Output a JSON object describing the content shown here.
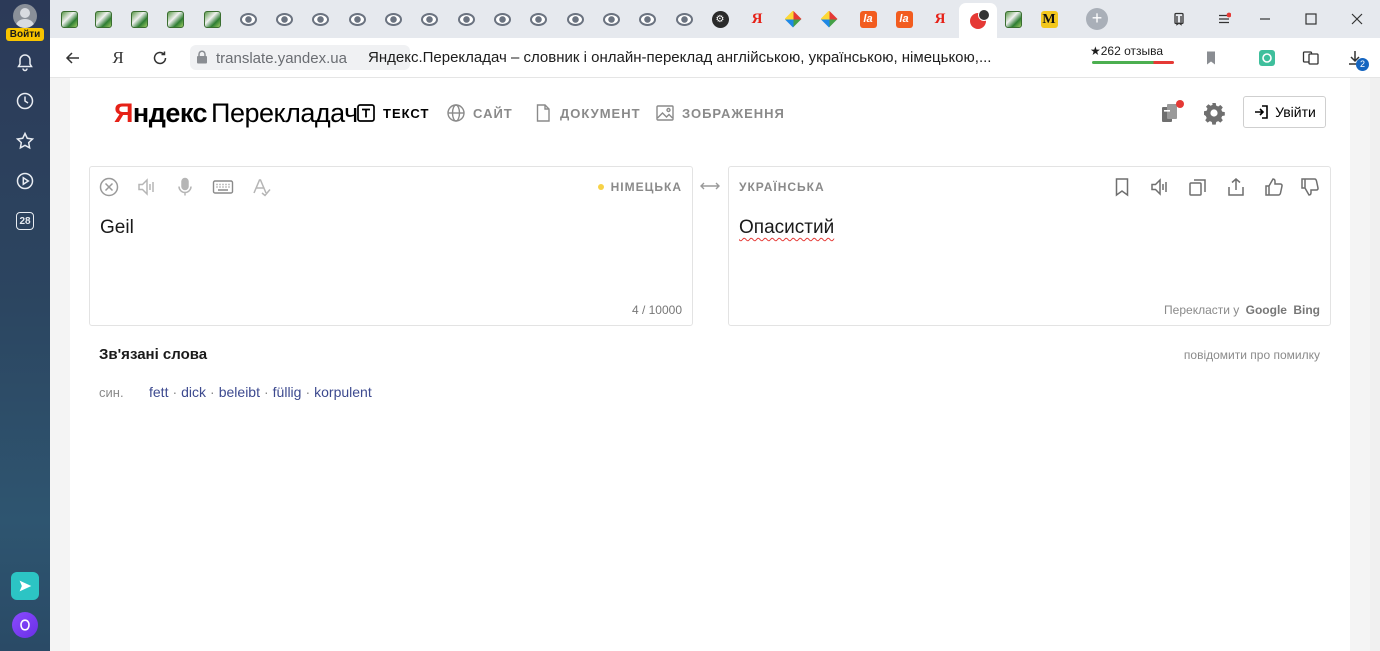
{
  "sidebar": {
    "login_label": "Войти",
    "calendar_day": "28",
    "icons": [
      "bell-icon",
      "history-icon",
      "star-icon",
      "play-icon",
      "calendar-icon",
      "send-app-icon",
      "alice-icon"
    ]
  },
  "tabs": {
    "favicons": [
      "image",
      "image",
      "image",
      "image",
      "image",
      "eye",
      "eye",
      "eye",
      "eye",
      "eye",
      "eye",
      "eye",
      "eye",
      "eye",
      "eye",
      "eye",
      "eye",
      "eye",
      "dark",
      "yandex",
      "multi",
      "multi",
      "la",
      "la",
      "yandex",
      "active",
      "image",
      "m"
    ],
    "new_tab": "+"
  },
  "address_bar": {
    "yandex_button": "Я",
    "domain": "translate.yandex.ua",
    "page_title": "Яндекс.Перекладач – словник і онлайн-переклад англійською, українською, німецькою,...",
    "reviews": "★262 отзыва",
    "downloads_count": "2"
  },
  "header": {
    "logo_part1_first": "Я",
    "logo_part1_rest": "ндекс",
    "logo_part2": "Перекладач",
    "nav": [
      {
        "label": "ТЕКСТ",
        "active": true
      },
      {
        "label": "САЙТ",
        "active": false
      },
      {
        "label": "ДОКУМЕНТ",
        "active": false
      },
      {
        "label": "ЗОБРАЖЕННЯ",
        "active": false
      }
    ],
    "login_label": "Увійти"
  },
  "source": {
    "language": "НІМЕЦЬКА",
    "text": "Geil",
    "char_count": "4 / 10000"
  },
  "target": {
    "language": "УКРАЇНСЬКА",
    "text": "Опасистий",
    "also_translate_label": "Перекласти у",
    "engine_google": "Google",
    "engine_bing": "Bing"
  },
  "related": {
    "title": "Зв'язані слова",
    "report_link": "повідомити про помилку",
    "syn_label": "син.",
    "synonyms": [
      "fett",
      "dick",
      "beleibt",
      "füllig",
      "korpulent"
    ],
    "separator": "·"
  },
  "colors": {
    "accent_red": "#e62117",
    "link_blue": "#3d4a8f",
    "lang_dot": "#f7d247"
  }
}
